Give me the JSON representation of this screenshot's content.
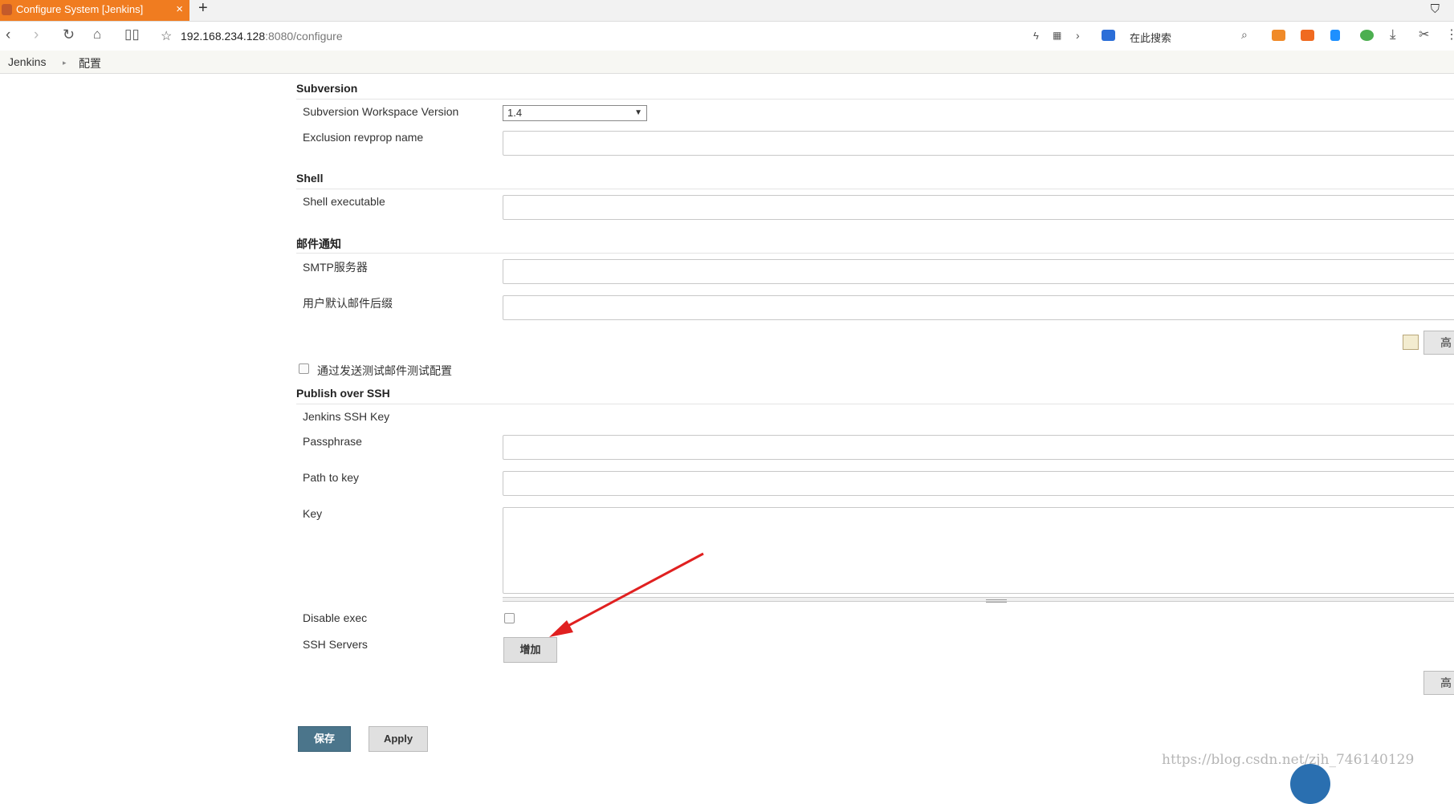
{
  "browser": {
    "tab_title": "Configure System [Jenkins]",
    "url_host": "192.168.234.128",
    "url_rest": ":8080/configure",
    "search_placeholder": "在此搜索"
  },
  "breadcrumb": [
    "Jenkins",
    "配置"
  ],
  "sections": {
    "subversion": {
      "title": "Subversion",
      "workspace_version_label": "Subversion Workspace Version",
      "workspace_version_value": "1.4",
      "exclusion_label": "Exclusion revprop name"
    },
    "shell": {
      "title": "Shell",
      "executable_label": "Shell executable"
    },
    "mail": {
      "title": "邮件通知",
      "smtp_label": "SMTP服务器",
      "suffix_label": "用户默认邮件后缀",
      "advanced_label": "高",
      "test_checkbox_label": "通过发送测试邮件测试配置"
    },
    "ssh": {
      "title": "Publish over SSH",
      "key_header": "Jenkins SSH Key",
      "passphrase_label": "Passphrase",
      "path_label": "Path to key",
      "key_label": "Key",
      "disable_label": "Disable exec",
      "servers_label": "SSH Servers",
      "add_button": "增加",
      "advanced_label": "高"
    }
  },
  "footer": {
    "save": "保存",
    "apply": "Apply"
  },
  "watermark": "https://blog.csdn.net/zjh_746140129",
  "colors": {
    "tab_active": "#f07c20",
    "save_button": "#4b758b",
    "arrow": "#e02020"
  }
}
